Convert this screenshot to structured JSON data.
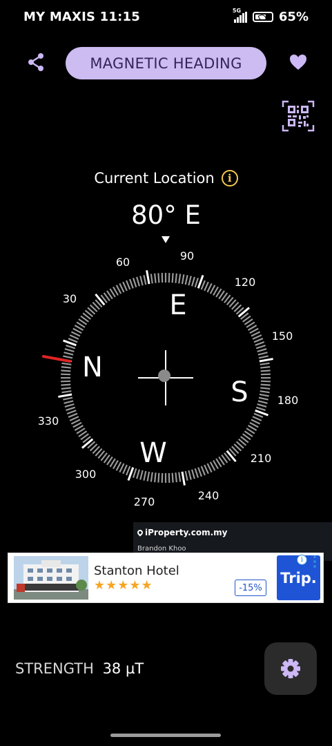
{
  "status_bar": {
    "carrier_time": "MY MAXIS 11:15",
    "network": "5G",
    "battery": "65%"
  },
  "top_bar": {
    "mode_label": "MAGNETIC HEADING",
    "share_icon": "share-icon",
    "favorite_icon": "heart-icon",
    "qr_icon": "qr-code-icon"
  },
  "location": {
    "label": "Current Location",
    "info_glyph": "i"
  },
  "heading": {
    "readout": "80° E",
    "degrees": 80
  },
  "compass": {
    "tick_labels": [
      "60",
      "90",
      "120",
      "150",
      "180",
      "210",
      "240",
      "270",
      "300",
      "330",
      "30"
    ],
    "cardinals": [
      "N",
      "E",
      "S",
      "W"
    ],
    "north_marker_color": "#e02424"
  },
  "ad_banner": {
    "source": "iProperty.com.my",
    "author": "Brandon Khoo"
  },
  "hotel_ad": {
    "title": "Stanton Hotel",
    "stars": "★★★★★",
    "discount": "-15%",
    "brand": "Trip.",
    "info_glyph": "i"
  },
  "strength": {
    "label": "STRENGTH",
    "value": "38 µT"
  },
  "settings_icon": "gear-icon",
  "colors": {
    "accent": "#ccbcf2",
    "accent_text": "#33245c",
    "info": "#f3c94f",
    "north": "#e02424"
  }
}
